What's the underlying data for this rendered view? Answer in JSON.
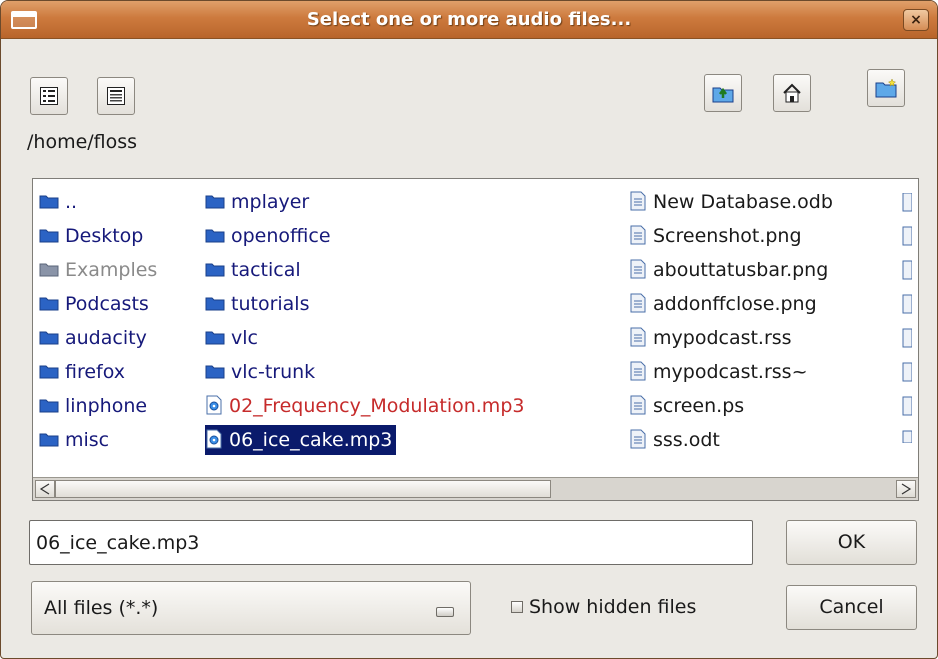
{
  "window": {
    "title": "Select one or more audio files...",
    "close_glyph": "×"
  },
  "toolbar": {
    "left_buttons": [
      "detail-view-icon",
      "list-view-icon"
    ],
    "right_buttons": [
      "parent-folder-icon",
      "home-folder-icon",
      "new-folder-icon"
    ]
  },
  "current_path": "/home/floss",
  "file_list": {
    "column1": [
      {
        "name": "..",
        "type": "folder"
      },
      {
        "name": "Desktop",
        "type": "folder"
      },
      {
        "name": "Examples",
        "type": "folder-dim"
      },
      {
        "name": "Podcasts",
        "type": "folder"
      },
      {
        "name": "audacity",
        "type": "folder"
      },
      {
        "name": "firefox",
        "type": "folder"
      },
      {
        "name": "linphone",
        "type": "folder"
      },
      {
        "name": "misc",
        "type": "folder"
      }
    ],
    "column2": [
      {
        "name": "mplayer",
        "type": "folder"
      },
      {
        "name": "openoffice",
        "type": "folder"
      },
      {
        "name": "tactical",
        "type": "folder"
      },
      {
        "name": "tutorials",
        "type": "folder"
      },
      {
        "name": "vlc",
        "type": "folder"
      },
      {
        "name": "vlc-trunk",
        "type": "folder"
      },
      {
        "name": "02_Frequency_Modulation.mp3",
        "type": "audio"
      },
      {
        "name": "06_ice_cake.mp3",
        "type": "audio-selected"
      }
    ],
    "column3": [
      {
        "name": "New Database.odb",
        "type": "document"
      },
      {
        "name": "Screenshot.png",
        "type": "document"
      },
      {
        "name": "abouttatusbar.png",
        "type": "document"
      },
      {
        "name": "addonffclose.png",
        "type": "document"
      },
      {
        "name": "mypodcast.rss",
        "type": "document"
      },
      {
        "name": "mypodcast.rss~",
        "type": "document"
      },
      {
        "name": "screen.ps",
        "type": "document"
      },
      {
        "name": "sss.odt",
        "type": "document"
      }
    ],
    "colors": {
      "folder_text": "#16197a",
      "audio_text": "#c62b2b",
      "selection_bg": "#0a1a6b",
      "dim_text": "#8a8a8a"
    }
  },
  "filename_input": {
    "value": "06_ice_cake.mp3"
  },
  "buttons": {
    "ok": "OK",
    "cancel": "Cancel"
  },
  "filter": {
    "selected": "All files (*.*)"
  },
  "show_hidden": {
    "label": "Show hidden files",
    "checked": false
  }
}
